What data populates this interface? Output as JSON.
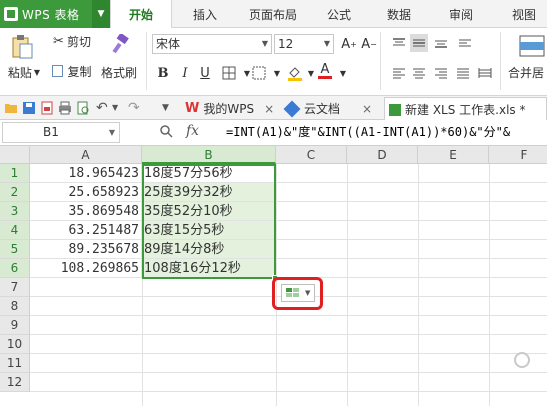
{
  "app": {
    "title": "WPS 表格",
    "brand_color": "#3c9a3c"
  },
  "menu": {
    "tabs": [
      "开始",
      "插入",
      "页面布局",
      "公式",
      "数据",
      "审阅",
      "视图"
    ],
    "active": "开始"
  },
  "ribbon": {
    "paste_label": "粘贴",
    "cut_label": "剪切",
    "copy_label": "复制",
    "format_painter_label": "格式刷",
    "font_name": "宋体",
    "font_size": "12",
    "bold": "B",
    "italic": "I",
    "underline": "U",
    "merge_label": "合并居",
    "grow_font": "A⁺",
    "shrink_font": "A⁻",
    "font_color_accent": "#e02020",
    "highlight_color": "#f5c400"
  },
  "doc_tabs": [
    {
      "label": "我的WPS",
      "icon": "wps-icon",
      "closable": true
    },
    {
      "label": "云文档",
      "icon": "cloud-doc-icon",
      "closable": true
    },
    {
      "label": "新建 XLS 工作表.xls *",
      "icon": "spreadsheet-icon",
      "closable": false,
      "active": true
    }
  ],
  "formula_bar": {
    "name_box": "B1",
    "fx": "fx",
    "formula": "=INT(A1)&\"度\"&INT((A1-INT(A1))*60)&\"分\"&"
  },
  "sheet": {
    "columns": [
      "A",
      "B",
      "C",
      "D",
      "E",
      "F"
    ],
    "selected_column": "B",
    "rows": [
      "1",
      "2",
      "3",
      "4",
      "5",
      "6",
      "7",
      "8",
      "9",
      "10",
      "11",
      "12"
    ],
    "selected_rows": [
      "1",
      "2",
      "3",
      "4",
      "5",
      "6"
    ],
    "data": [
      {
        "a": "18.965423",
        "b": "18度57分56秒"
      },
      {
        "a": "25.658923",
        "b": "25度39分32秒"
      },
      {
        "a": "35.869548",
        "b": "35度52分10秒"
      },
      {
        "a": "63.251487",
        "b": "63度15分5秒"
      },
      {
        "a": "89.235678",
        "b": "89度14分8秒"
      },
      {
        "a": "108.269865",
        "b": "108度16分12秒"
      }
    ],
    "selection_color": "#3c9a3c",
    "highlight_box_color": "#e02020"
  }
}
